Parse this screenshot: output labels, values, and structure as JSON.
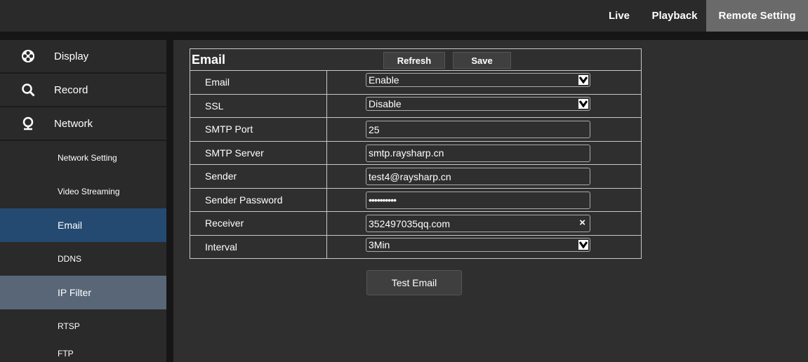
{
  "topnav": {
    "live": "Live",
    "playback": "Playback",
    "remote": "Remote Setting"
  },
  "sidebar": {
    "main": [
      {
        "label": "Display",
        "icon": "display-icon"
      },
      {
        "label": "Record",
        "icon": "search-icon"
      },
      {
        "label": "Network",
        "icon": "network-icon"
      }
    ],
    "sub": [
      "Network Setting",
      "Video Streaming",
      "Email",
      "DDNS",
      "IP Filter",
      "RTSP",
      "FTP"
    ]
  },
  "panel": {
    "title": "Email",
    "refresh": "Refresh",
    "save": "Save",
    "rows": [
      {
        "label": "Email",
        "value": "Enable"
      },
      {
        "label": "SSL",
        "value": "Disable"
      },
      {
        "label": "SMTP Port",
        "value": "25"
      },
      {
        "label": "SMTP Server",
        "value": "smtp.raysharp.cn"
      },
      {
        "label": "Sender",
        "value": "test4@raysharp.cn"
      },
      {
        "label": "Sender Password",
        "value": "••••••••••"
      },
      {
        "label": "Receiver",
        "value": "352497035qq.com"
      },
      {
        "label": "Interval",
        "value": "3Min"
      }
    ],
    "clear": "×"
  },
  "test_email": "Test Email"
}
